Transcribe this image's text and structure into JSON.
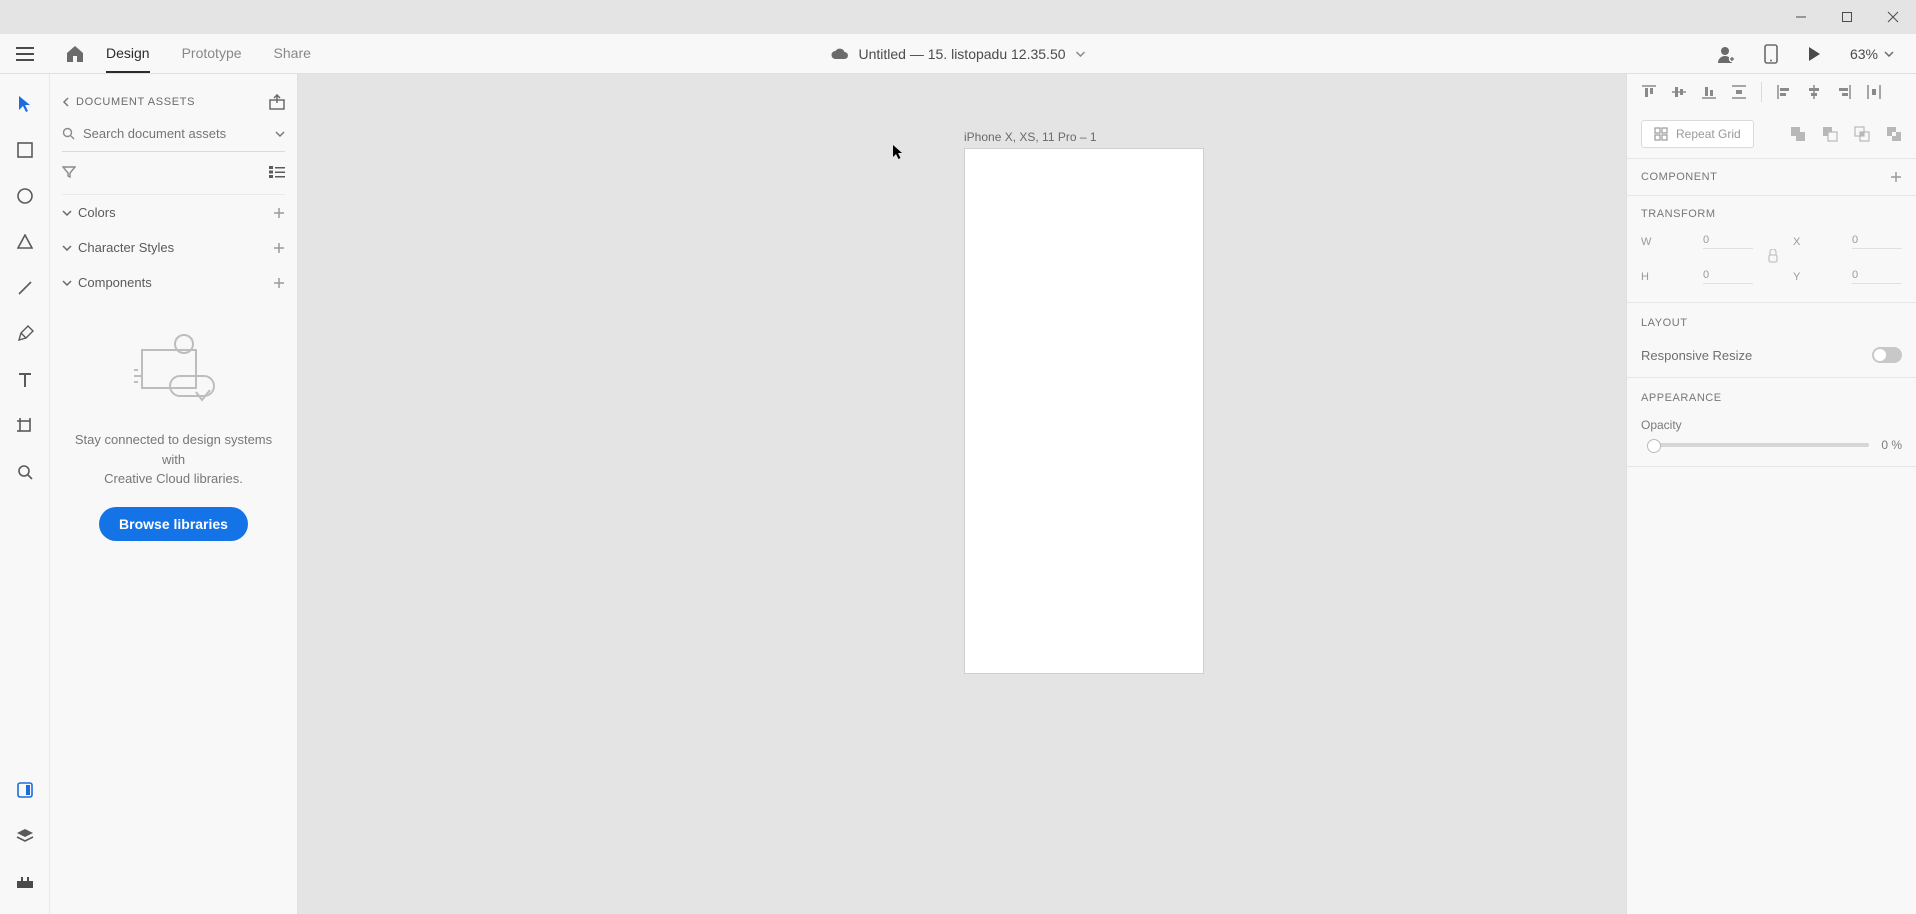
{
  "titlebar": {},
  "header": {
    "tabs": {
      "design": "Design",
      "prototype": "Prototype",
      "share": "Share"
    },
    "doc_title": "Untitled — 15. listopadu 12.35.50",
    "zoom": "63%"
  },
  "leftpanel": {
    "back_label": "DOCUMENT ASSETS",
    "search_placeholder": "Search document assets",
    "sections": {
      "colors": "Colors",
      "character_styles": "Character Styles",
      "components": "Components"
    },
    "empty_text_1": "Stay connected to design systems with",
    "empty_text_2": "Creative Cloud libraries.",
    "browse_label": "Browse libraries"
  },
  "canvas": {
    "artboard_label": "iPhone X, XS, 11 Pro – 1"
  },
  "rightpanel": {
    "repeat_grid": "Repeat Grid",
    "component_label": "COMPONENT",
    "transform": {
      "heading": "TRANSFORM",
      "w_label": "W",
      "w_value": "0",
      "h_label": "H",
      "h_value": "0",
      "x_label": "X",
      "x_value": "0",
      "y_label": "Y",
      "y_value": "0"
    },
    "layout": {
      "heading": "LAYOUT",
      "responsive_resize": "Responsive Resize"
    },
    "appearance": {
      "heading": "APPEARANCE",
      "opacity_label": "Opacity",
      "opacity_value": "0 %"
    }
  }
}
